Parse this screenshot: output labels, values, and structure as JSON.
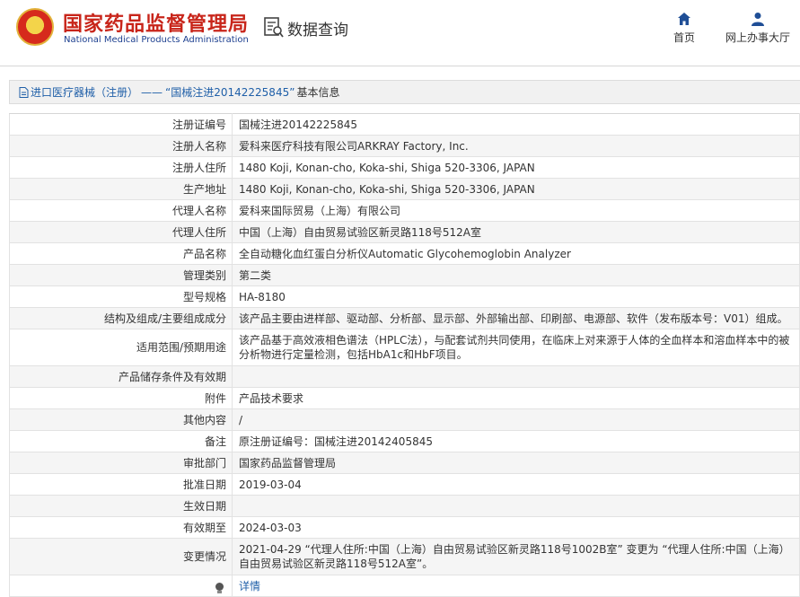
{
  "header": {
    "title": "国家药品监督管理局",
    "subtitle": "National Medical Products Administration",
    "query_label": "数据查询",
    "nav": {
      "home": "首页",
      "hall": "网上办事大厅"
    }
  },
  "breadcrumb": {
    "category": "进口医疗器械（注册）",
    "separator": "——",
    "current": "“国械注进20142225845”",
    "suffix": "基本信息"
  },
  "rows": [
    {
      "key": "注册证编号",
      "value": "国械注进20142225845"
    },
    {
      "key": "注册人名称",
      "value": "爱科来医疗科技有限公司ARKRAY Factory, Inc."
    },
    {
      "key": "注册人住所",
      "value": "1480 Koji, Konan-cho, Koka-shi, Shiga 520-3306, JAPAN"
    },
    {
      "key": "生产地址",
      "value": "1480 Koji, Konan-cho, Koka-shi, Shiga 520-3306, JAPAN"
    },
    {
      "key": "代理人名称",
      "value": "爱科来国际贸易（上海）有限公司"
    },
    {
      "key": "代理人住所",
      "value": "中国（上海）自由贸易试验区新灵路118号512A室"
    },
    {
      "key": "产品名称",
      "value": "全自动糖化血红蛋白分析仪Automatic Glycohemoglobin Analyzer"
    },
    {
      "key": "管理类别",
      "value": "第二类"
    },
    {
      "key": "型号规格",
      "value": "HA-8180"
    },
    {
      "key": "结构及组成/主要组成成分",
      "value": "该产品主要由进样部、驱动部、分析部、显示部、外部输出部、印刷部、电源部、软件（发布版本号：V01）组成。"
    },
    {
      "key": "适用范围/预期用途",
      "value": "该产品基于高效液相色谱法（HPLC法），与配套试剂共同使用，在临床上对来源于人体的全血样本和溶血样本中的被分析物进行定量检测，包括HbA1c和HbF项目。"
    },
    {
      "key": "产品储存条件及有效期",
      "value": ""
    },
    {
      "key": "附件",
      "value": "产品技术要求"
    },
    {
      "key": "其他内容",
      "value": "/"
    },
    {
      "key": "备注",
      "value": "原注册证编号：国械注进20142405845"
    },
    {
      "key": "审批部门",
      "value": "国家药品监督管理局"
    },
    {
      "key": "批准日期",
      "value": "2019-03-04"
    },
    {
      "key": "生效日期",
      "value": ""
    },
    {
      "key": "有效期至",
      "value": "2024-03-03"
    },
    {
      "key": "变更情况",
      "value": "2021-04-29 “代理人住所:中国（上海）自由贸易试验区新灵路118号1002B室” 变更为 “代理人住所:中国（上海）自由贸易试验区新灵路118号512A室”。"
    }
  ],
  "details_label": "详情"
}
